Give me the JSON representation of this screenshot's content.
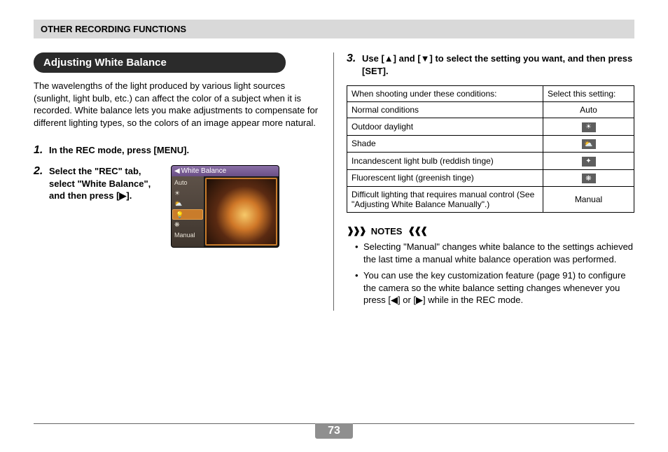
{
  "header": "OTHER RECORDING FUNCTIONS",
  "section_title": "Adjusting White Balance",
  "intro": "The wavelengths of the light produced by various light sources (sunlight, light bulb, etc.) can affect the color of a subject when it is recorded. White balance lets you make adjustments to compensate for different lighting types, so the colors of an image appear more natural.",
  "steps": {
    "s1": {
      "num": "1.",
      "text": "In the REC mode, press [MENU]."
    },
    "s2": {
      "num": "2.",
      "text": "Select the \"REC\" tab, select \"White Balance\", and then press [▶]."
    },
    "s3": {
      "num": "3.",
      "text": "Use [▲] and [▼] to select the setting you want, and then press [SET]."
    }
  },
  "lcd": {
    "title": "White Balance",
    "items": [
      "Auto",
      "☀",
      "⛅",
      "💡",
      "❋",
      "Manual"
    ],
    "selected_index": 3
  },
  "table": {
    "head": {
      "c1": "When shooting under these conditions:",
      "c2": "Select this setting:"
    },
    "rows": [
      {
        "cond": "Normal conditions",
        "setting_text": "Auto",
        "icon": null
      },
      {
        "cond": "Outdoor daylight",
        "setting_text": null,
        "icon": "☀"
      },
      {
        "cond": "Shade",
        "setting_text": null,
        "icon": "⛅"
      },
      {
        "cond": "Incandescent light bulb (reddish tinge)",
        "setting_text": null,
        "icon": "✦"
      },
      {
        "cond": "Fluorescent light (greenish tinge)",
        "setting_text": null,
        "icon": "❋"
      },
      {
        "cond": "Difficult lighting that requires manual control (See \"Adjusting White Balance Manually\".)",
        "setting_text": "Manual",
        "icon": null
      }
    ]
  },
  "notes_label": "NOTES",
  "notes": [
    "Selecting \"Manual\" changes white balance to the settings achieved the last time a manual white balance operation was performed.",
    "You can use the key customization feature (page 91) to configure the camera so the white balance setting changes whenever you press [◀] or [▶] while in the REC mode."
  ],
  "page_number": "73"
}
